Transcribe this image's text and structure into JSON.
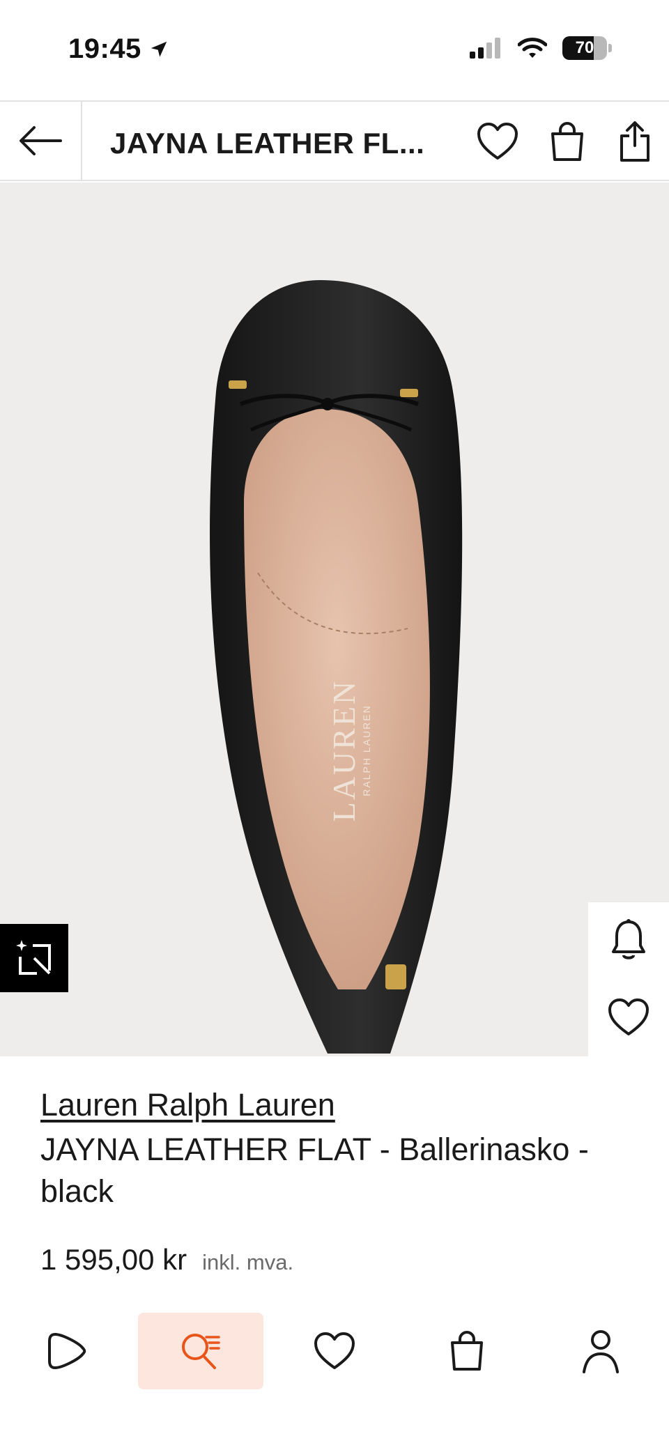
{
  "status_bar": {
    "time": "19:45",
    "battery": "70"
  },
  "header": {
    "title": "JAYNA LEATHER FL..."
  },
  "product_image": {
    "logo_text": "LAUREN",
    "logo_subtext": "RALPH LAUREN",
    "background_color": "#eeedec"
  },
  "product": {
    "brand": "Lauren Ralph Lauren",
    "name": "JAYNA LEATHER FLAT - Ballerinasko - black",
    "price": "1 595,00 kr",
    "vat_note": "inkl. mva."
  },
  "bottom_nav": {
    "items": [
      {
        "icon": "play-icon",
        "active": false
      },
      {
        "icon": "search-icon",
        "active": true
      },
      {
        "icon": "heart-icon",
        "active": false
      },
      {
        "icon": "bag-icon",
        "active": false
      },
      {
        "icon": "user-icon",
        "active": false
      }
    ],
    "accent_color": "#e8541a"
  }
}
